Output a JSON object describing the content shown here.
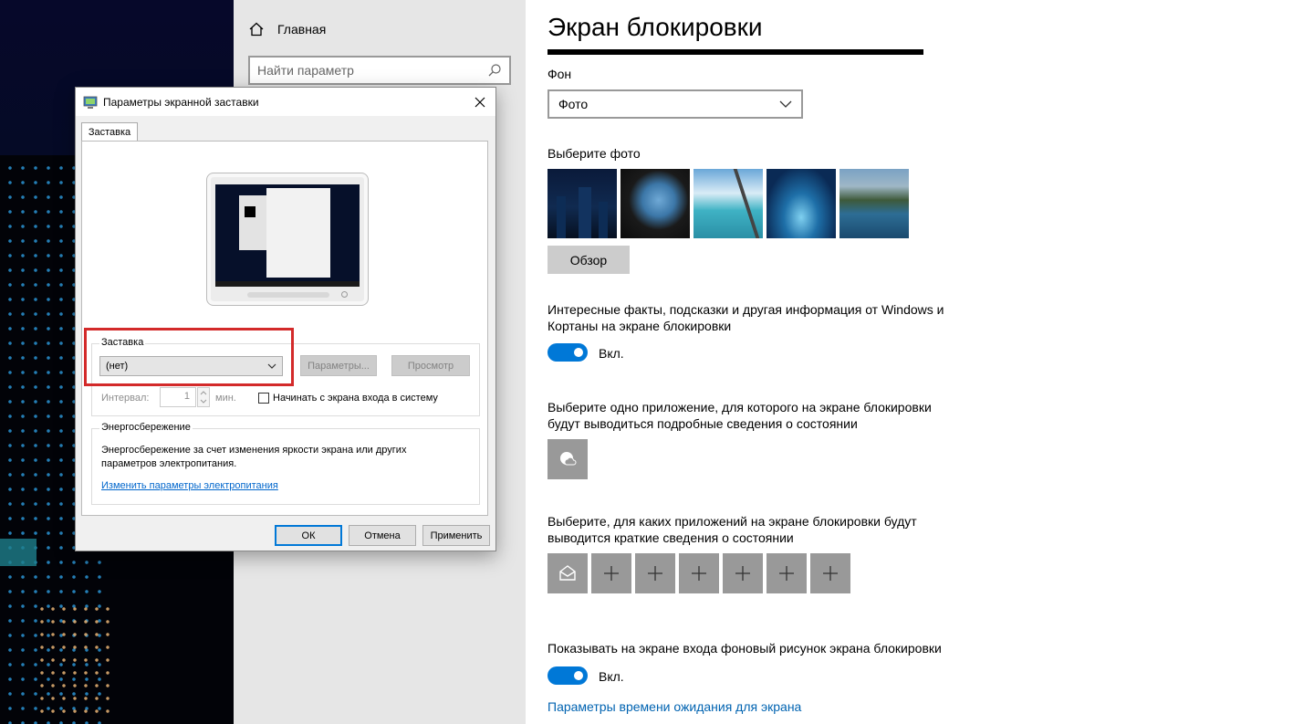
{
  "nav": {
    "home_label": "Главная",
    "search_placeholder": "Найти параметр"
  },
  "main": {
    "title": "Экран блокировки",
    "background_label": "Фон",
    "background_value": "Фото",
    "choose_photo_label": "Выберите фото",
    "browse_button": "Обзор",
    "facts_text": "Интересные факты, подсказки и другая информация от Windows и Кортаны на экране блокировки",
    "facts_toggle_label": "Вкл.",
    "detailed_status_text": "Выберите одно приложение, для которого на экране блокировки будут выводиться подробные сведения о состоянии",
    "quick_status_text": "Выберите, для каких приложений на экране блокировки будут выводится краткие сведения о состоянии",
    "signin_bg_text": "Показывать на экране входа фоновый рисунок экрана блокировки",
    "signin_toggle_label": "Вкл.",
    "timeout_link": "Параметры времени ожидания для экрана"
  },
  "dialog": {
    "title": "Параметры экранной заставки",
    "tab_label": "Заставка",
    "screensaver_group_title": "Заставка",
    "screensaver_value": "(нет)",
    "params_button": "Параметры...",
    "preview_button": "Просмотр",
    "interval_label": "Интервал:",
    "interval_value": "1",
    "minutes_label": "мин.",
    "resume_checkbox_label": "Начинать с экрана входа в систему",
    "power_group_title": "Энергосбережение",
    "power_text": "Энергосбережение за счет изменения яркости экрана или других параметров электропитания.",
    "power_link": "Изменить параметры электропитания",
    "ok_button": "ОК",
    "cancel_button": "Отмена",
    "apply_button": "Применить"
  },
  "colors": {
    "accent": "#0078d7",
    "link": "#0063b1",
    "highlight_box": "#d32a2a"
  }
}
